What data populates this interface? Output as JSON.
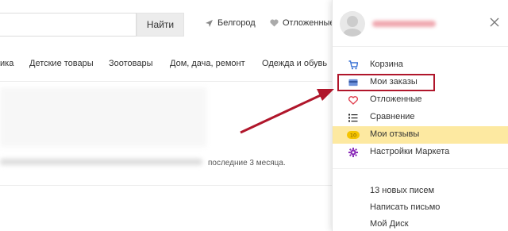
{
  "header": {
    "search_placeholder": "",
    "search_button": "Найти",
    "region": "Белгород",
    "saved": "Отложенные"
  },
  "categories": [
    {
      "label": "ика"
    },
    {
      "label": "Детские товары"
    },
    {
      "label": "Зоотовары"
    },
    {
      "label": "Дом, дача, ремонт"
    },
    {
      "label": "Одежда и обувь"
    }
  ],
  "content": {
    "tail_text": "последние 3 месяца."
  },
  "dropdown": {
    "items": [
      {
        "label": "Корзина",
        "icon": "cart-icon"
      },
      {
        "label": "Мои заказы",
        "icon": "card-icon"
      },
      {
        "label": "Отложенные",
        "icon": "heart-icon"
      },
      {
        "label": "Сравнение",
        "icon": "list-icon"
      },
      {
        "label": "Мои отзывы",
        "icon": "review-badge-icon",
        "badge": "10"
      },
      {
        "label": "Настройки Маркета",
        "icon": "gear-icon"
      }
    ],
    "mail_links": [
      {
        "label": "13 новых писем"
      },
      {
        "label": "Написать письмо"
      },
      {
        "label": "Мой Диск"
      }
    ]
  },
  "colors": {
    "highlight": "#fde9a1",
    "annotation_red": "#b0162b",
    "cart_blue": "#3b73d6",
    "heart_red": "#e03a4a",
    "gear_purple": "#8a2cb8"
  }
}
